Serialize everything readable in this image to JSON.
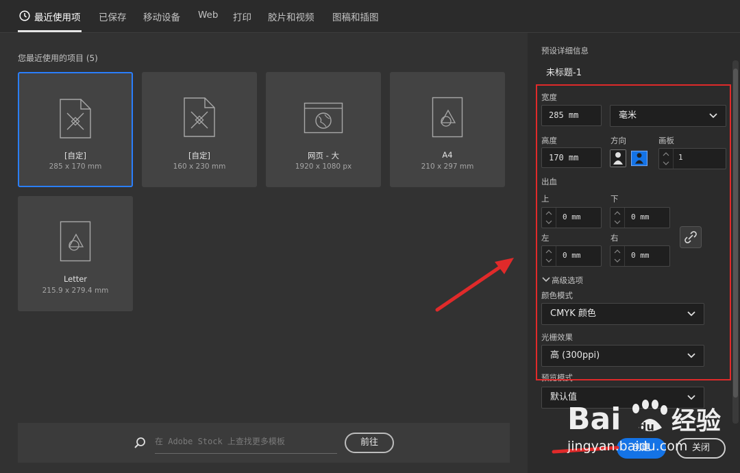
{
  "tabs": [
    {
      "label": "最近使用项"
    },
    {
      "label": "已保存"
    },
    {
      "label": "移动设备"
    },
    {
      "label": "Web"
    },
    {
      "label": "打印"
    },
    {
      "label": "胶片和视频"
    },
    {
      "label": "图稿和插图"
    }
  ],
  "recent": {
    "title": "您最近使用的项目 (5)",
    "cards": [
      {
        "name": "[自定]",
        "dims": "285 x 170 mm",
        "icon": "custom-document-icon"
      },
      {
        "name": "[自定]",
        "dims": "160 x 230 mm",
        "icon": "custom-document-icon"
      },
      {
        "name": "网页 - 大",
        "dims": "1920 x 1080 px",
        "icon": "web-browser-icon"
      },
      {
        "name": "A4",
        "dims": "210 x 297 mm",
        "icon": "shapes-document-icon"
      },
      {
        "name": "Letter",
        "dims": "215.9 x 279.4 mm",
        "icon": "shapes-document-icon"
      }
    ]
  },
  "stock": {
    "placeholder": "在 Adobe Stock 上查找更多模板",
    "go_label": "前往"
  },
  "preset": {
    "section_title": "预设详细信息",
    "doc_name": "未标题-1",
    "width_label": "宽度",
    "width_value": "285 mm",
    "unit_value": "毫米",
    "height_label": "高度",
    "height_value": "170 mm",
    "orientation_label": "方向",
    "artboard_label": "画板",
    "artboard_value": "1",
    "bleed_label": "出血",
    "bleed_top_label": "上",
    "bleed_top_value": "0 mm",
    "bleed_bottom_label": "下",
    "bleed_bottom_value": "0 mm",
    "bleed_left_label": "左",
    "bleed_left_value": "0 mm",
    "bleed_right_label": "右",
    "bleed_right_value": "0 mm",
    "advanced_label": "高级选项",
    "color_mode_label": "颜色模式",
    "color_mode_value": "CMYK 颜色",
    "raster_label": "光栅效果",
    "raster_value": "高 (300ppi)",
    "preview_label": "预览模式",
    "preview_value": "默认值"
  },
  "actions": {
    "create_label": "创建",
    "close_label": "关闭"
  },
  "watermark": {
    "brand": "Bai",
    "brand2": "经验",
    "url": "jingyan.baidu.com"
  },
  "colors": {
    "accent": "#1473e6",
    "annotation": "#e02a2a",
    "selected_border": "#2a7fff"
  }
}
